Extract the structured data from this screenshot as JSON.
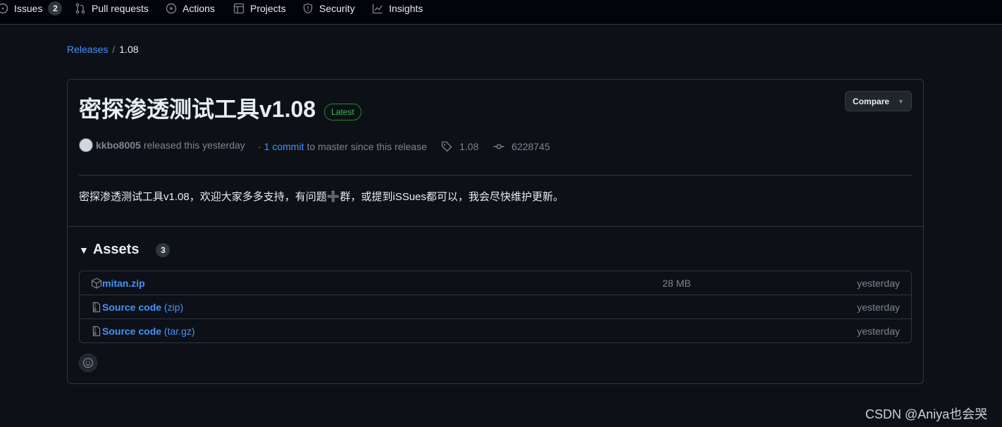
{
  "topnav": {
    "items": [
      {
        "label": "Issues",
        "count": "2"
      },
      {
        "label": "Pull requests"
      },
      {
        "label": "Actions"
      },
      {
        "label": "Projects"
      },
      {
        "label": "Security"
      },
      {
        "label": "Insights"
      }
    ]
  },
  "breadcrumb": {
    "root": "Releases",
    "separator": "/",
    "current": "1.08"
  },
  "release": {
    "title": "密探渗透测试工具v1.08",
    "badge": "Latest",
    "compare_label": "Compare",
    "author": "kkbo8005",
    "released_text": "released this yesterday",
    "dot": "·",
    "commits_link": "1 commit",
    "commits_rest": "to master since this release",
    "tag": "1.08",
    "commit_sha": "6228745",
    "body": "密探渗透测试工具v1.08，欢迎大家多多支持，有问题➕群，或提到iSSues都可以，我会尽快维护更新。"
  },
  "assets": {
    "title": "Assets",
    "count": "3",
    "rows": [
      {
        "name": "mitan.zip",
        "ext": "",
        "size": "28 MB",
        "date": "yesterday",
        "icon": "package-icon"
      },
      {
        "name": "Source code",
        "ext": "(zip)",
        "size": "",
        "date": "yesterday",
        "icon": "file-zip-icon"
      },
      {
        "name": "Source code",
        "ext": "(tar.gz)",
        "size": "",
        "date": "yesterday",
        "icon": "file-zip-icon"
      }
    ]
  },
  "watermark": "CSDN @Aniya也会哭",
  "colors": {
    "accent": "#4493f8",
    "latest": "#3fb950",
    "background": "#0d1117"
  }
}
